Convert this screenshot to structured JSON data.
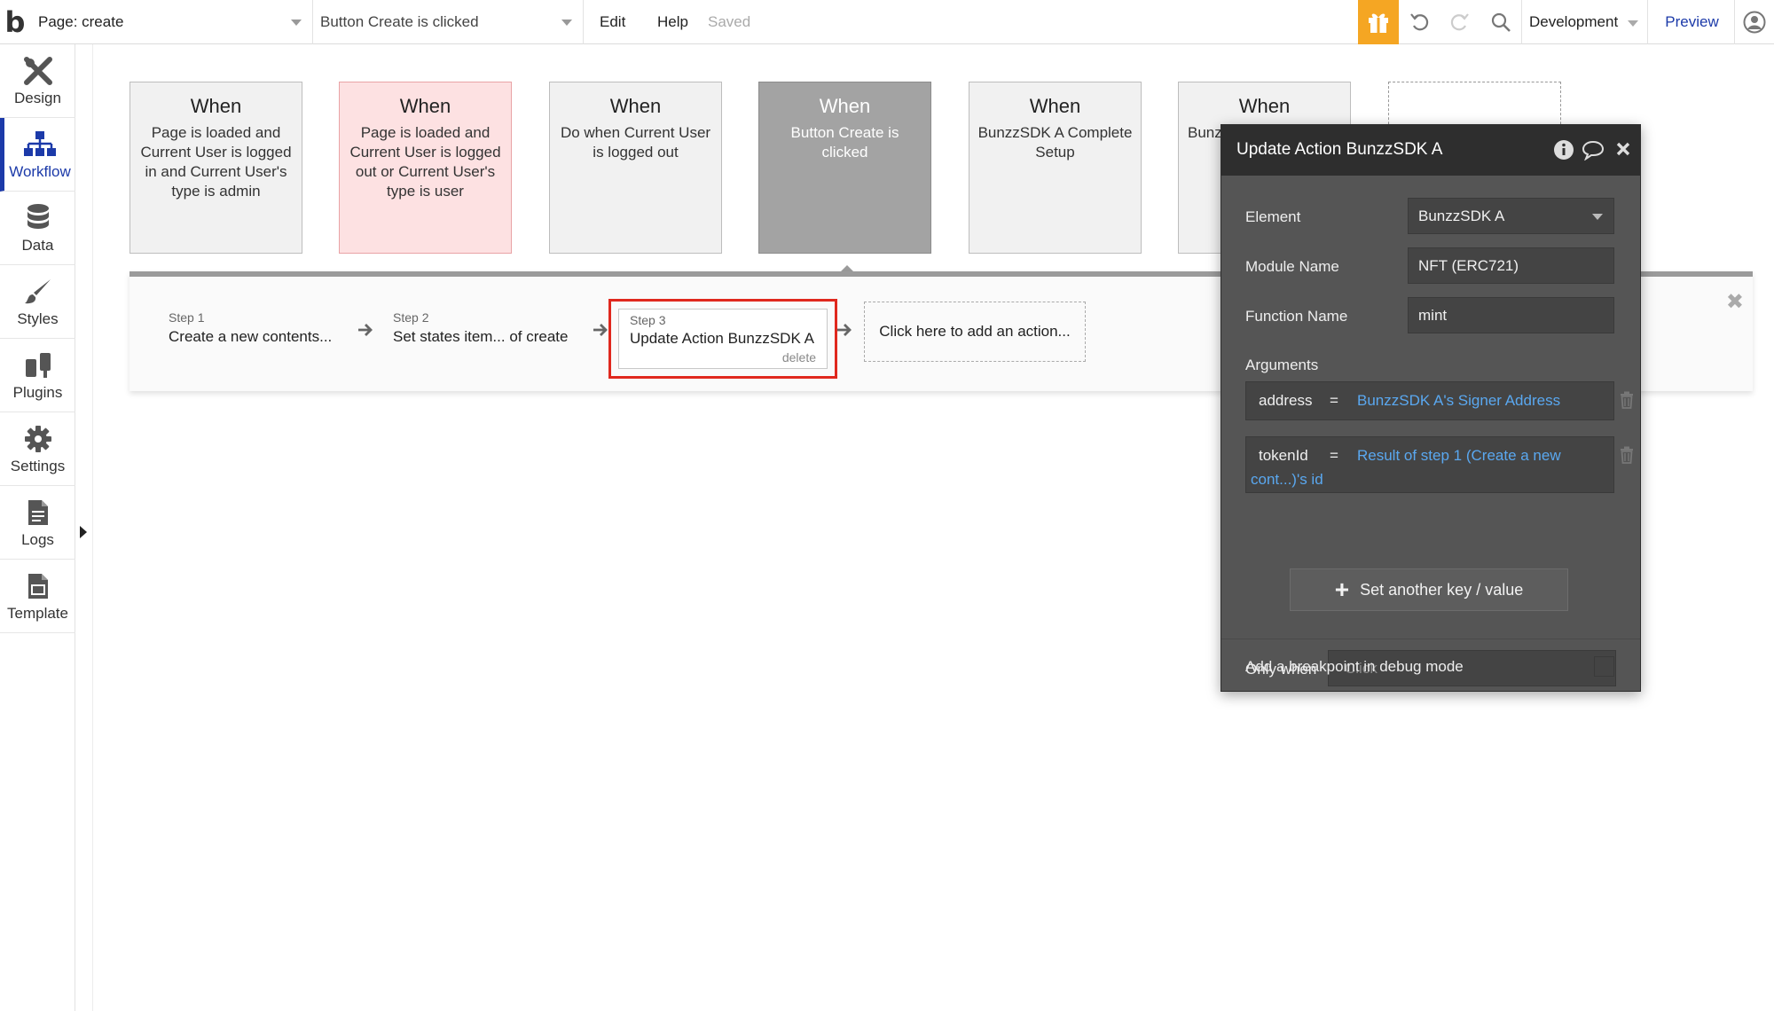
{
  "topbar": {
    "logo": "b",
    "page_label": "Page: create",
    "event_select": "Button Create is clicked",
    "edit": "Edit",
    "help": "Help",
    "saved": "Saved",
    "env": "Development",
    "preview": "Preview"
  },
  "nav": [
    {
      "label": "Design",
      "icon": "design-icon"
    },
    {
      "label": "Workflow",
      "icon": "workflow-icon",
      "active": true
    },
    {
      "label": "Data",
      "icon": "database-icon"
    },
    {
      "label": "Styles",
      "icon": "brush-icon"
    },
    {
      "label": "Plugins",
      "icon": "plug-icon"
    },
    {
      "label": "Settings",
      "icon": "gear-icon"
    },
    {
      "label": "Logs",
      "icon": "document-icon"
    },
    {
      "label": "Template",
      "icon": "template-icon"
    }
  ],
  "events": [
    {
      "when": "When",
      "desc": "Page is loaded and Current User is logged in and Current User's type is admin"
    },
    {
      "when": "When",
      "desc": "Page is loaded and Current User is logged out or Current User's type is user"
    },
    {
      "when": "When",
      "desc": "Do when Current User is logged out"
    },
    {
      "when": "When",
      "desc": "Button Create is clicked"
    },
    {
      "when": "When",
      "desc": "BunzzSDK A Complete Setup"
    },
    {
      "when": "When",
      "desc": "Bunz"
    }
  ],
  "steps": [
    {
      "num": "Step 1",
      "title": "Create a new contents..."
    },
    {
      "num": "Step 2",
      "title": "Set states item... of create"
    },
    {
      "num": "Step 3",
      "title": "Update Action BunzzSDK A",
      "delete": "delete"
    }
  ],
  "add_action": "Click here to add an action...",
  "panel": {
    "title": "Update Action BunzzSDK A",
    "element_label": "Element",
    "element_value": "BunzzSDK A",
    "module_label": "Module Name",
    "module_value": "NFT (ERC721)",
    "function_label": "Function Name",
    "function_value": "mint",
    "arguments_label": "Arguments",
    "args": [
      {
        "key": "address",
        "eq": "=",
        "value": "BunzzSDK A's Signer Address"
      },
      {
        "key": "tokenId",
        "eq": "=",
        "value_line1": "Result of step 1 (Create a new",
        "value_line2": "cont...)'s id"
      }
    ],
    "set_another": "Set another key / value",
    "only_when_label": "Only when",
    "only_when_placeholder": "Click",
    "breakpoint_label": "Add a breakpoint in debug mode"
  },
  "colors": {
    "accent": "#1c3aa9",
    "gift": "#f5a623",
    "highlight": "#e0281e",
    "dynamic_value": "#5aa8f0"
  }
}
